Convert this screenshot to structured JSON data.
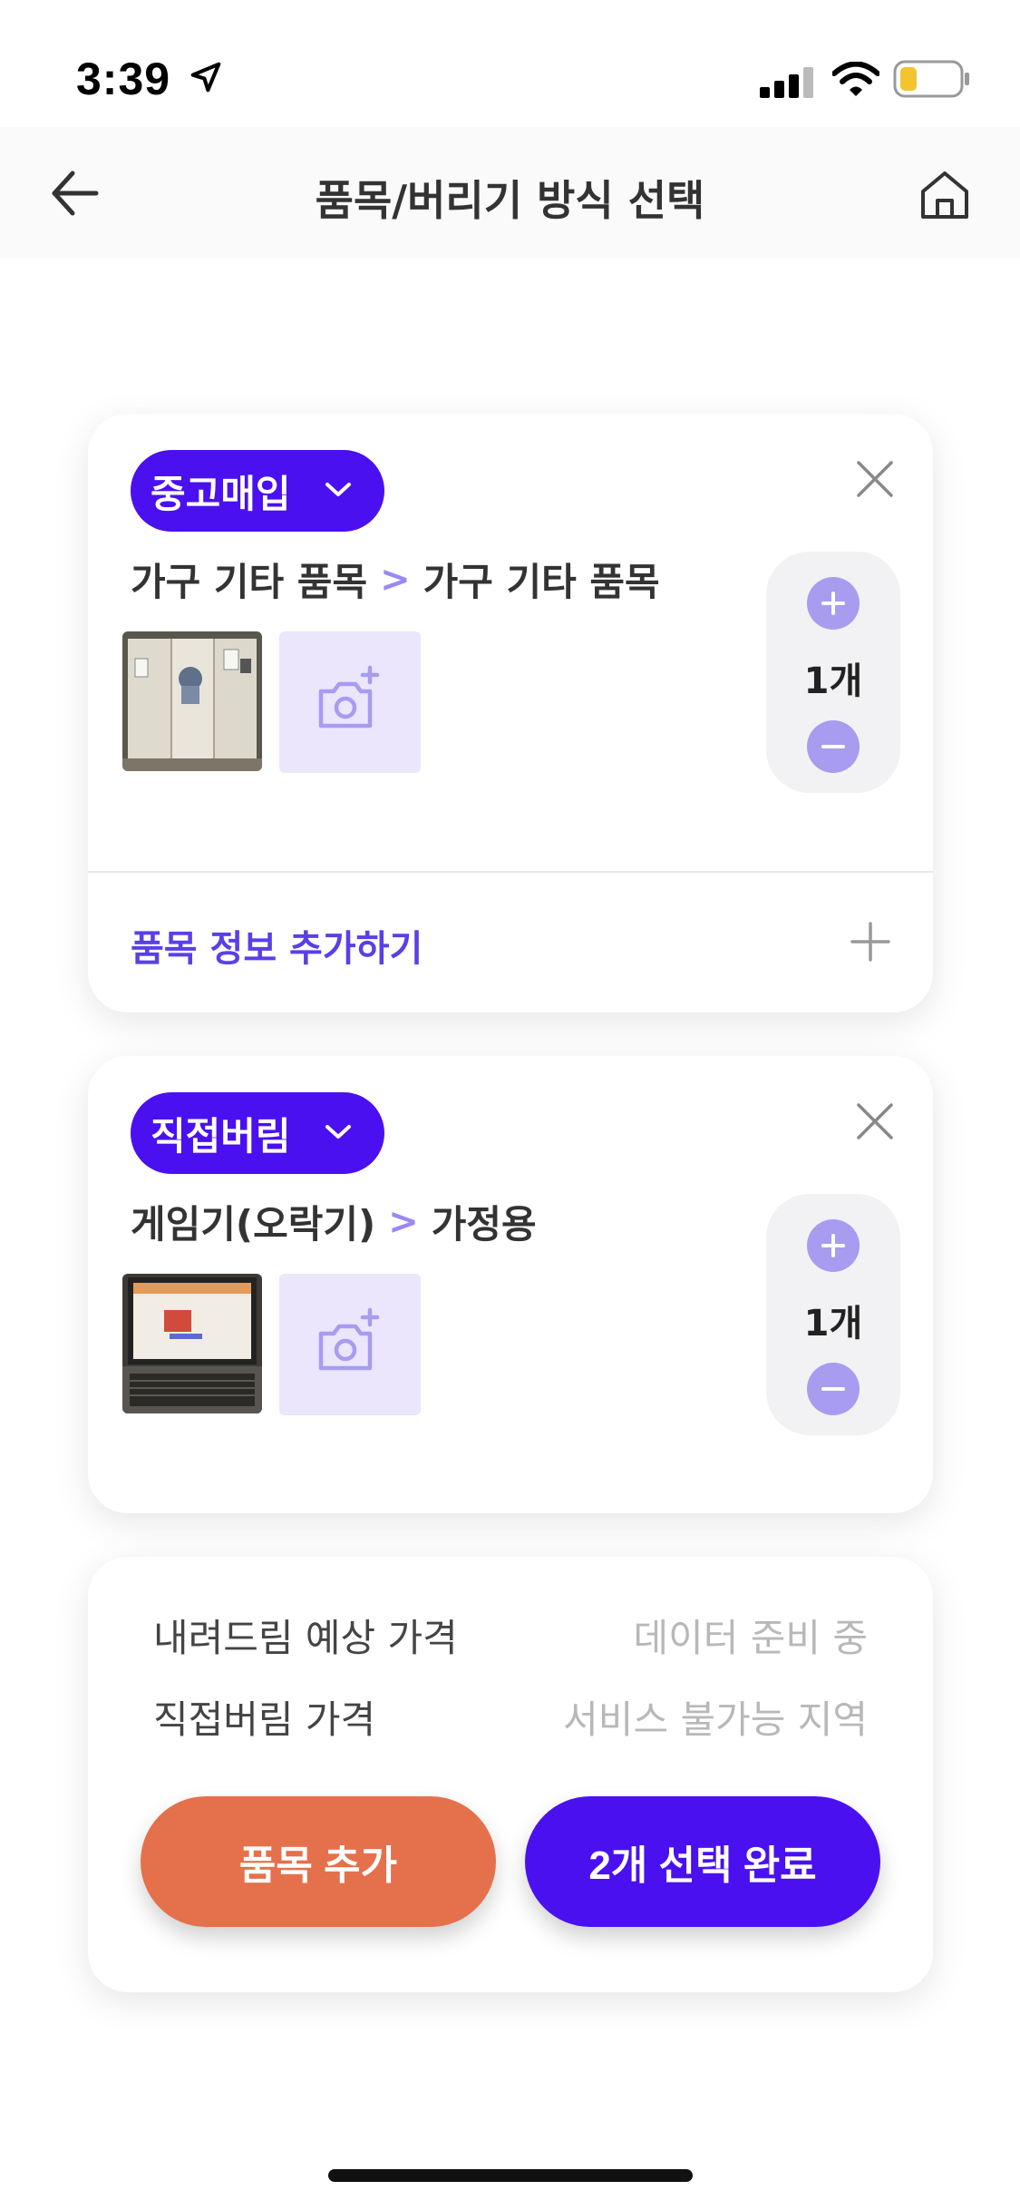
{
  "status_bar": {
    "time": "3:39"
  },
  "header": {
    "title": "품목/버리기 방식 선택"
  },
  "items": [
    {
      "method": "중고매입",
      "category": "가구 기타 품목",
      "subcategory": "가구 기타 품목",
      "separator": ">",
      "quantity": "1개"
    },
    {
      "method": "직접버림",
      "category": "게임기(오락기)",
      "subcategory": "가정용",
      "separator": ">",
      "quantity": "1개"
    }
  ],
  "add_info": {
    "label": "품목 정보 추가하기"
  },
  "summary": {
    "expected_label": "내려드림 예상 가격",
    "expected_value": "데이터 준비 중",
    "direct_label": "직접버림 가격",
    "direct_value": "서비스 불가능 지역"
  },
  "actions": {
    "add_label": "품목 추가",
    "done_label": "2개 선택 완료"
  },
  "colors": {
    "primary": "#4a10f0",
    "accent_orange": "#e4714c",
    "qty_button": "#a79cf0",
    "photo_add_bg": "#ebe6fb"
  }
}
